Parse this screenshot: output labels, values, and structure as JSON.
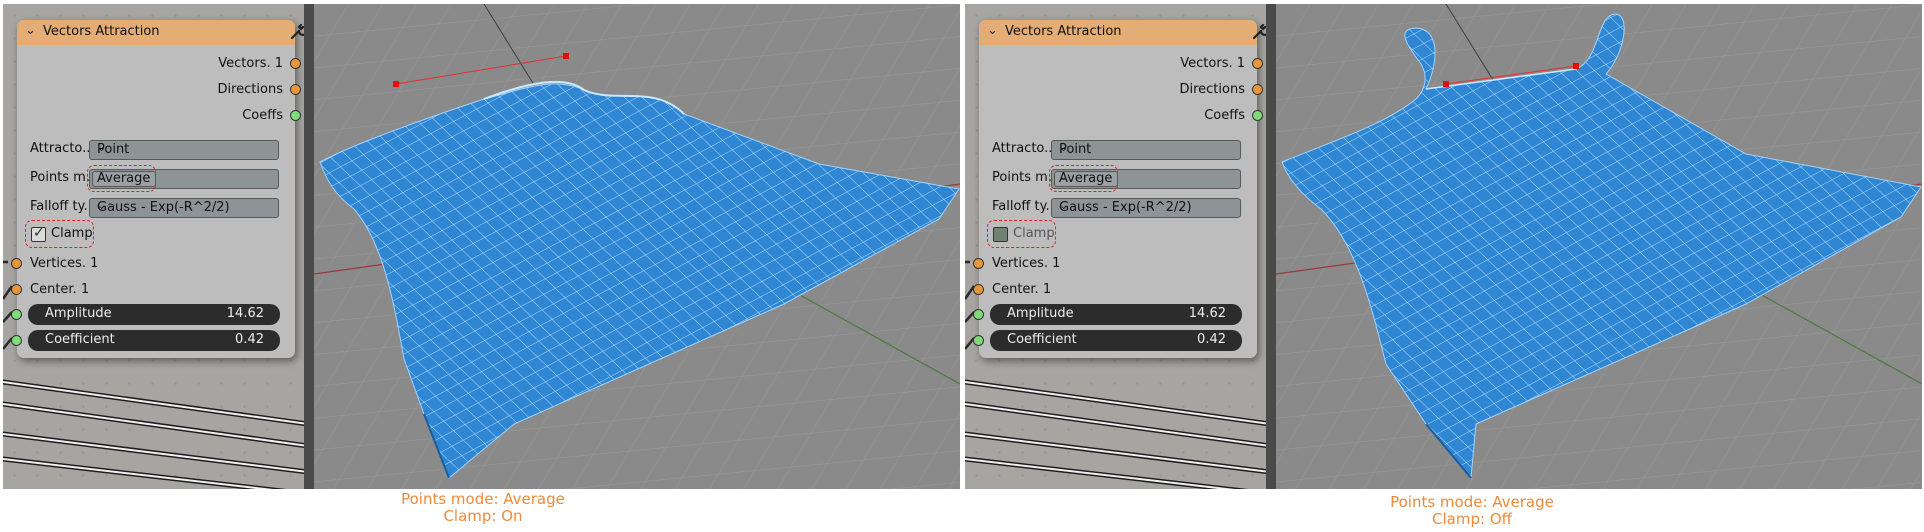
{
  "panels": [
    {
      "node": {
        "title": "Vectors Attraction",
        "outputs": [
          "Vectors. 1",
          "Directions",
          "Coeffs"
        ],
        "attractor_label": "Attracto...",
        "attractor_value": "Point",
        "points_mode_label": "Points m...",
        "points_mode_value": "Average",
        "falloff_label": "Falloff ty...",
        "falloff_value": "Gauss - Exp(-R^2/2)",
        "clamp_label": "Clamp",
        "clamp_checked": true,
        "inputs": [
          "Vertices. 1",
          "Center. 1"
        ],
        "amplitude_label": "Amplitude",
        "amplitude_value": "14.62",
        "coefficient_label": "Coefficient",
        "coefficient_value": "0.42"
      },
      "caption_line1": "Points mode: Average",
      "caption_line2": "Clamp: On"
    },
    {
      "node": {
        "title": "Vectors Attraction",
        "outputs": [
          "Vectors. 1",
          "Directions",
          "Coeffs"
        ],
        "attractor_label": "Attracto...",
        "attractor_value": "Point",
        "points_mode_label": "Points m...",
        "points_mode_value": "Average",
        "falloff_label": "Falloff ty...",
        "falloff_value": "Gauss - Exp(-R^2/2)",
        "clamp_label": "Clamp",
        "clamp_checked": false,
        "inputs": [
          "Vertices. 1",
          "Center. 1"
        ],
        "amplitude_label": "Amplitude",
        "amplitude_value": "14.62",
        "coefficient_label": "Coefficient",
        "coefficient_value": "0.42"
      },
      "caption_line1": "Points mode: Average",
      "caption_line2": "Clamp: Off"
    }
  ],
  "colors": {
    "node_header": "#e3ad75",
    "mesh_fill": "#2f86d2",
    "mesh_wire": "#b6e0ff",
    "highlight": "#d9222b",
    "caption": "#ee8a3c"
  },
  "icons": {
    "collapse": "chevron-down-icon",
    "tool": "wrench-icon",
    "checkbox": "checkmark-icon"
  }
}
